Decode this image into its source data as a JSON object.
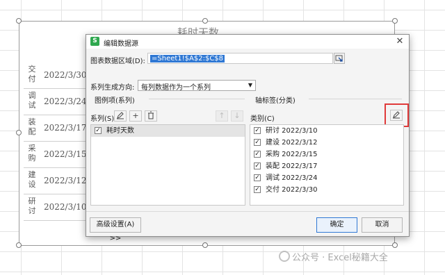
{
  "chart": {
    "title": "耗时天数",
    "rows": [
      {
        "category": "交付",
        "date": "2022/3/30"
      },
      {
        "category": "调试",
        "date": "2022/3/24"
      },
      {
        "category": "装配",
        "date": "2022/3/17"
      },
      {
        "category": "采购",
        "date": "2022/3/15"
      },
      {
        "category": "建设",
        "date": "2022/3/12"
      },
      {
        "category": "研讨",
        "date": "2022/3/10"
      }
    ]
  },
  "dialog": {
    "app_icon": "S",
    "title": "编辑数据源",
    "close_glyph": "✕",
    "data_range_label": "图表数据区域(D):",
    "data_range_value": "=Sheet1!$A$2:$C$8",
    "series_direction_label": "系列生成方向:",
    "series_direction_value": "每列数据作为一个系列",
    "legend_group_title": "图例项(系列)",
    "series_label": "系列(S)",
    "series_items": [
      {
        "label": "耗时天数",
        "checked": true,
        "selected": true
      }
    ],
    "axis_group_title": "轴标签(分类)",
    "category_label": "类别(C)",
    "category_items": [
      {
        "label": "研讨 2022/3/10",
        "checked": true
      },
      {
        "label": "建设 2022/3/12",
        "checked": true
      },
      {
        "label": "采购 2022/3/15",
        "checked": true
      },
      {
        "label": "装配 2022/3/17",
        "checked": true
      },
      {
        "label": "调试 2022/3/24",
        "checked": true
      },
      {
        "label": "交付 2022/3/30",
        "checked": true
      }
    ],
    "advanced_label": "高级设置(A) >>",
    "ok_label": "确定",
    "cancel_label": "取消",
    "check_glyph": "✓"
  },
  "watermark": "公众号 · Excel秘籍大全",
  "colors": {
    "accent": "#2f78d4",
    "highlight": "#e03a3a",
    "app_icon": "#2fa84f"
  },
  "icons": {
    "edit": "pencil-icon",
    "add": "plus-icon",
    "delete": "trash-icon",
    "up": "arrow-up-icon",
    "down": "arrow-down-icon",
    "collapse": "collapse-range-icon"
  }
}
